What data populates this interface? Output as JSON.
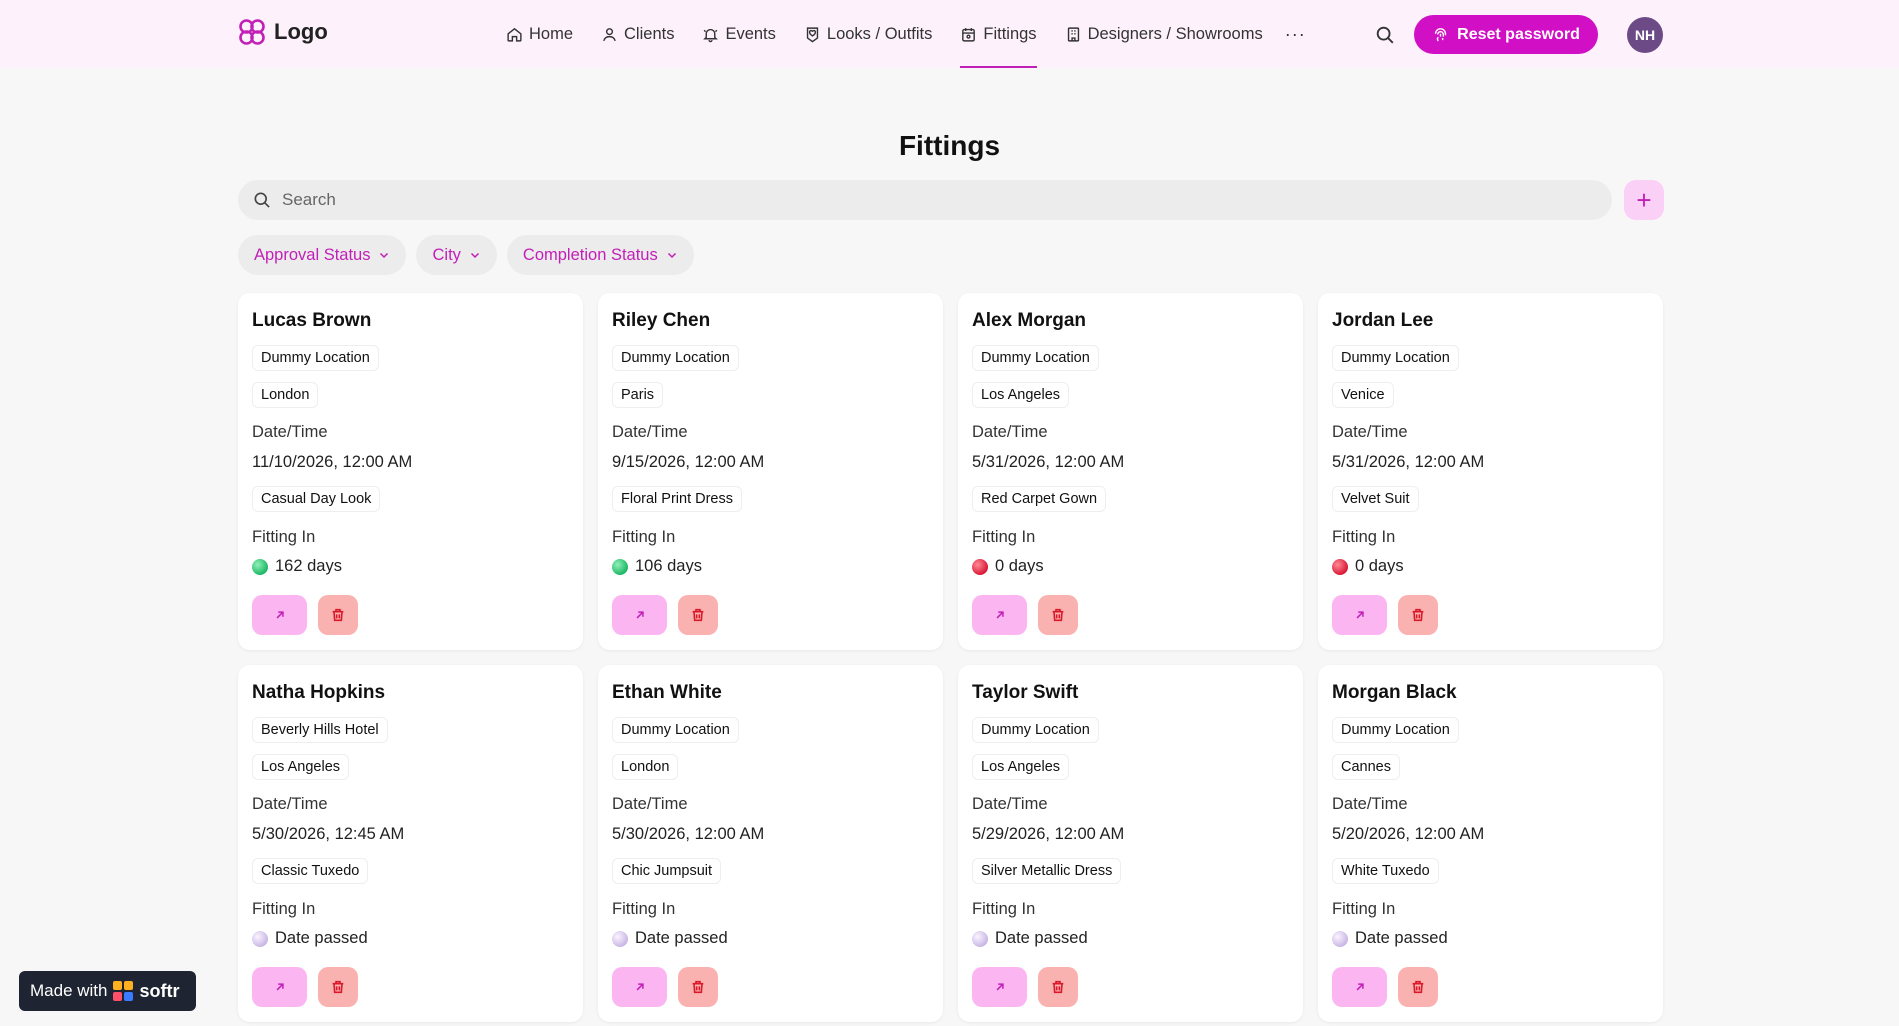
{
  "header": {
    "logo_text": "Logo",
    "nav": [
      {
        "label": "Home",
        "icon": "home-icon"
      },
      {
        "label": "Clients",
        "icon": "user-icon"
      },
      {
        "label": "Events",
        "icon": "bell-icon"
      },
      {
        "label": "Looks / Outfits",
        "icon": "heart-tag-icon"
      },
      {
        "label": "Fittings",
        "icon": "calendar-icon",
        "active": true
      },
      {
        "label": "Designers / Showrooms",
        "icon": "building-icon"
      }
    ],
    "more_label": "···",
    "reset_password_label": "Reset password",
    "avatar_initials": "NH",
    "accent_color": "#d10fc4"
  },
  "main": {
    "title": "Fittings",
    "search_placeholder": "Search",
    "add_label": "+",
    "filters": [
      "Approval Status",
      "City",
      "Completion Status"
    ]
  },
  "cards": [
    {
      "name": "Lucas Brown",
      "location": "Dummy Location",
      "city": "London",
      "date_label": "Date/Time",
      "date": "11/10/2026, 12:00 AM",
      "look": "Casual Day Look",
      "fitting_label": "Fitting In",
      "fitting_status": "green",
      "fitting_value": "162 days"
    },
    {
      "name": "Riley Chen",
      "location": "Dummy Location",
      "city": "Paris",
      "date_label": "Date/Time",
      "date": "9/15/2026, 12:00 AM",
      "look": "Floral Print Dress",
      "fitting_label": "Fitting In",
      "fitting_status": "green",
      "fitting_value": "106 days"
    },
    {
      "name": "Alex Morgan",
      "location": "Dummy Location",
      "city": "Los Angeles",
      "date_label": "Date/Time",
      "date": "5/31/2026, 12:00 AM",
      "look": "Red Carpet Gown",
      "fitting_label": "Fitting In",
      "fitting_status": "red",
      "fitting_value": "0 days"
    },
    {
      "name": "Jordan Lee",
      "location": "Dummy Location",
      "city": "Venice",
      "date_label": "Date/Time",
      "date": "5/31/2026, 12:00 AM",
      "look": "Velvet Suit",
      "fitting_label": "Fitting In",
      "fitting_status": "red",
      "fitting_value": "0 days"
    },
    {
      "name": "Natha Hopkins",
      "location": "Beverly Hills Hotel",
      "city": "Los Angeles",
      "date_label": "Date/Time",
      "date": "5/30/2026, 12:45 AM",
      "look": "Classic Tuxedo",
      "fitting_label": "Fitting In",
      "fitting_status": "passed",
      "fitting_value": "Date passed"
    },
    {
      "name": "Ethan White",
      "location": "Dummy Location",
      "city": "London",
      "date_label": "Date/Time",
      "date": "5/30/2026, 12:00 AM",
      "look": "Chic Jumpsuit",
      "fitting_label": "Fitting In",
      "fitting_status": "passed",
      "fitting_value": "Date passed"
    },
    {
      "name": "Taylor Swift",
      "location": "Dummy Location",
      "city": "Los Angeles",
      "date_label": "Date/Time",
      "date": "5/29/2026, 12:00 AM",
      "look": "Silver Metallic Dress",
      "fitting_label": "Fitting In",
      "fitting_status": "passed",
      "fitting_value": "Date passed"
    },
    {
      "name": "Morgan Black",
      "location": "Dummy Location",
      "city": "Cannes",
      "date_label": "Date/Time",
      "date": "5/20/2026, 12:00 AM",
      "look": "White Tuxedo",
      "fitting_label": "Fitting In",
      "fitting_status": "passed",
      "fitting_value": "Date passed"
    }
  ],
  "footer_badge": {
    "made_with": "Made with",
    "brand": "softr"
  }
}
